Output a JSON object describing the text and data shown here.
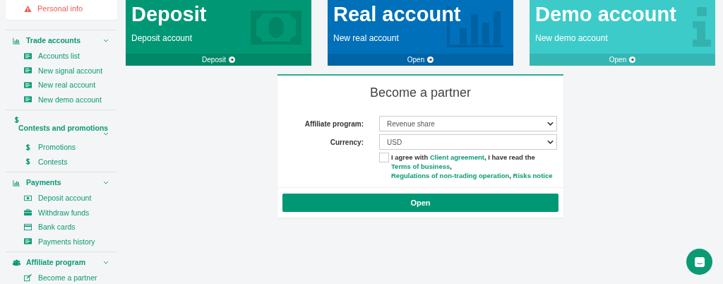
{
  "profile_menu": {
    "items": [
      {
        "label": "Personal info",
        "kind": "warning"
      }
    ]
  },
  "sidebar": {
    "sections": [
      {
        "title": "Trade accounts",
        "kind": "chart",
        "expanded": true,
        "items": [
          {
            "label": "Accounts list",
            "kind": "list"
          },
          {
            "label": "New signal account",
            "kind": "list"
          },
          {
            "label": "New real account",
            "kind": "list"
          },
          {
            "label": "New demo account",
            "kind": "list"
          }
        ]
      },
      {
        "title": "Contests and promotions",
        "kind": "dollar",
        "expanded": true,
        "items": [
          {
            "label": "Promotions",
            "kind": "dollar"
          },
          {
            "label": "Contests",
            "kind": "dollar"
          }
        ]
      },
      {
        "title": "Payments",
        "kind": "chart",
        "expanded": true,
        "items": [
          {
            "label": "Deposit account",
            "kind": "money"
          },
          {
            "label": "Withdraw funds",
            "kind": "briefcase"
          },
          {
            "label": "Bank cards",
            "kind": "card"
          },
          {
            "label": "Payments history",
            "kind": "list"
          }
        ]
      },
      {
        "title": "Affiliate program",
        "kind": "users",
        "expanded": true,
        "items": [
          {
            "label": "Become a partner",
            "kind": "edit"
          }
        ]
      }
    ]
  },
  "tiles": [
    {
      "title": "Deposit",
      "subtitle": "Deposit account",
      "action": "Deposit",
      "color": "#009874",
      "kind": "money"
    },
    {
      "title": "Real account",
      "subtitle": "New real account",
      "action": "Open",
      "color": "#0070ba",
      "kind": "chart"
    },
    {
      "title": "Demo account",
      "subtitle": "New demo account",
      "action": "Open",
      "color": "#3ccbc9",
      "kind": "info"
    }
  ],
  "form": {
    "title": "Become a partner",
    "fields": [
      {
        "label": "Affiliate program:",
        "value": "Revenue share"
      },
      {
        "label": "Currency:",
        "value": "USD"
      }
    ],
    "agreement": {
      "checked": false,
      "parts": [
        {
          "kind": "text",
          "text": "I agree with"
        },
        {
          "kind": "link",
          "text": "Client agreement"
        },
        {
          "kind": "text",
          "text": ", I have read the"
        },
        {
          "kind": "link",
          "text": "Terms of business"
        },
        {
          "kind": "text",
          "text": ","
        },
        {
          "kind": "link",
          "text": "Regulations of non-trading operation"
        },
        {
          "kind": "text",
          "text": ","
        },
        {
          "kind": "link",
          "text": "Risks notice"
        }
      ]
    },
    "submit": "Open"
  }
}
